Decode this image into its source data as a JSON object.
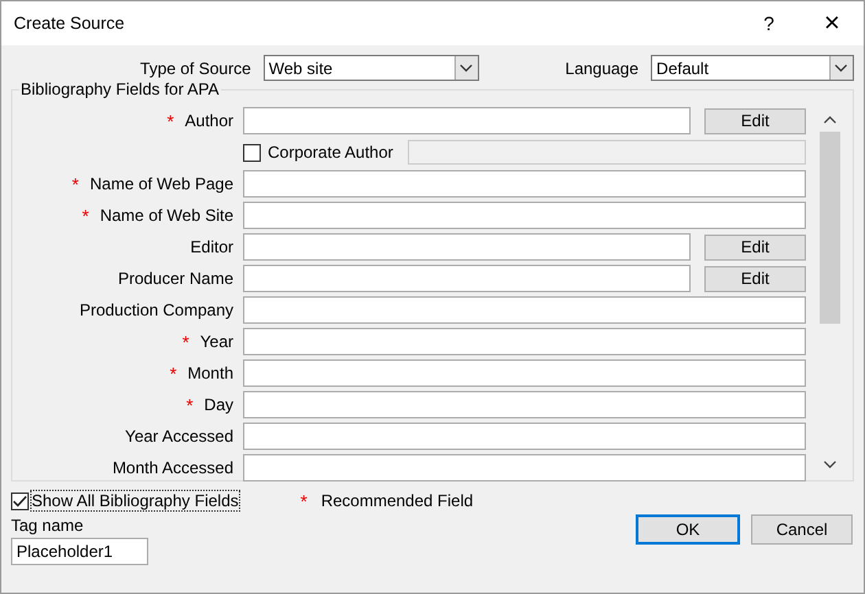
{
  "window": {
    "title": "Create Source",
    "help": "?",
    "close": "×"
  },
  "type_of_source": {
    "label": "Type of Source",
    "value": "Web site"
  },
  "language": {
    "label": "Language",
    "value": "Default"
  },
  "group": {
    "title": "Bibliography Fields for APA",
    "rows": [
      {
        "kind": "field",
        "label": "Author",
        "required": true,
        "value": "",
        "edit": "Edit"
      },
      {
        "kind": "checkbox",
        "label": "Corporate Author",
        "checked": false,
        "disabled_field": true
      },
      {
        "kind": "field",
        "label": "Name of Web Page",
        "required": true,
        "value": ""
      },
      {
        "kind": "field",
        "label": "Name of Web Site",
        "required": true,
        "value": ""
      },
      {
        "kind": "field",
        "label": "Editor",
        "required": false,
        "value": "",
        "edit": "Edit"
      },
      {
        "kind": "field",
        "label": "Producer Name",
        "required": false,
        "value": "",
        "edit": "Edit"
      },
      {
        "kind": "field",
        "label": "Production Company",
        "required": false,
        "value": ""
      },
      {
        "kind": "field",
        "label": "Year",
        "required": true,
        "value": ""
      },
      {
        "kind": "field",
        "label": "Month",
        "required": true,
        "value": ""
      },
      {
        "kind": "field",
        "label": "Day",
        "required": true,
        "value": ""
      },
      {
        "kind": "field",
        "label": "Year Accessed",
        "required": false,
        "value": ""
      },
      {
        "kind": "field",
        "label": "Month Accessed",
        "required": false,
        "value": ""
      }
    ]
  },
  "show_all": {
    "label": "Show All Bibliography Fields",
    "checked": true
  },
  "legend": {
    "star": "*",
    "label": "Recommended Field"
  },
  "tag_name": {
    "label": "Tag name",
    "value": "Placeholder1"
  },
  "buttons": [
    {
      "label": "OK",
      "default": true
    },
    {
      "label": "Cancel",
      "default": false
    }
  ]
}
